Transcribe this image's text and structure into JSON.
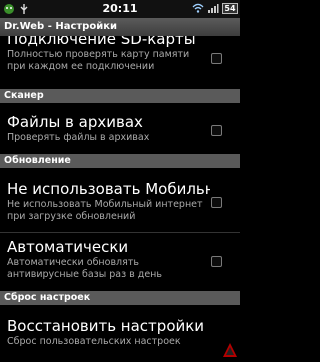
{
  "status_bar": {
    "time": "20:11",
    "battery": "54",
    "icons": [
      "green-robot-icon",
      "usb-icon",
      "wifi-icon",
      "signal-icon",
      "battery-icon"
    ]
  },
  "app": {
    "title": "Dr.Web - Настройки"
  },
  "prefs": {
    "sd_title": "Подключение SD-карты",
    "sd_summary": "Полностью проверять карту памяти при каждом ее подключении",
    "scanner_header": "Сканер",
    "archives_title": "Файлы в архивах",
    "archives_summary": "Проверять файлы в архивах",
    "update_header": "Обновление",
    "mobile_title": "Не использовать Мобильный интернет",
    "mobile_summary": "Не использовать Мобильный интернет при загрузке обновлений",
    "auto_title": "Автоматически",
    "auto_summary": "Автоматически обновлять антивирусные базы раз в день",
    "reset_header": "Сброс настроек",
    "restore_title": "Восстановить настройки",
    "restore_summary": "Сброс пользовательских настроек"
  },
  "colors": {
    "background": "#000000",
    "category_bg": "#5a5a5a",
    "summary_text": "#aaaaaa"
  }
}
